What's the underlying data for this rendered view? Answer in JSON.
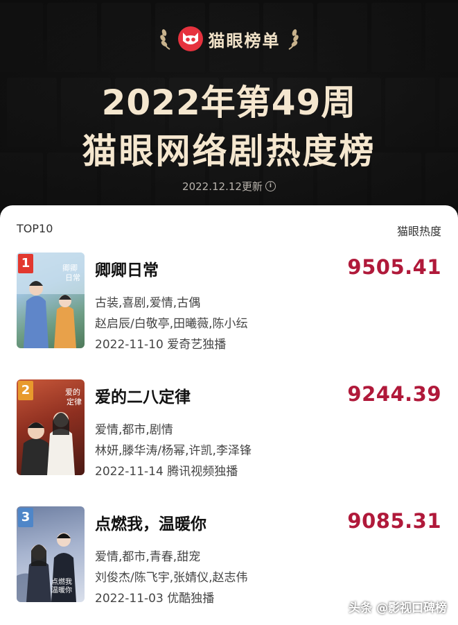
{
  "brand": {
    "name": "猫眼榜单",
    "logo_icon": "cat-eye-logo-icon",
    "color": "#e6323e"
  },
  "header": {
    "title_line1": "2022年第49周",
    "title_line2": "猫眼网络剧热度榜",
    "updated": "2022.12.12更新"
  },
  "list": {
    "left_label": "TOP10",
    "right_label": "猫眼热度",
    "items": [
      {
        "rank": "1",
        "name": "卿卿日常",
        "score": "9505.41",
        "genre": "古装,喜剧,爱情,古偶",
        "cast": "赵启辰/白敬亭,田曦薇,陈小纭",
        "release": "2022-11-10 爱奇艺独播",
        "rank_color": "#e2382f"
      },
      {
        "rank": "2",
        "name": "爱的二八定律",
        "score": "9244.39",
        "genre": "爱情,都市,剧情",
        "cast": "林妍,滕华涛/杨幂,许凯,李泽锋",
        "release": "2022-11-14 腾讯视频独播",
        "rank_color": "#e89a2c"
      },
      {
        "rank": "3",
        "name": "点燃我，温暖你",
        "score": "9085.31",
        "genre": "爱情,都市,青春,甜宠",
        "cast": "刘俊杰/陈飞宇,张婧仪,赵志伟",
        "release": "2022-11-03 优酷独播",
        "rank_color": "#4f86c8"
      }
    ]
  },
  "watermark": "头条 @影视口碑榜"
}
